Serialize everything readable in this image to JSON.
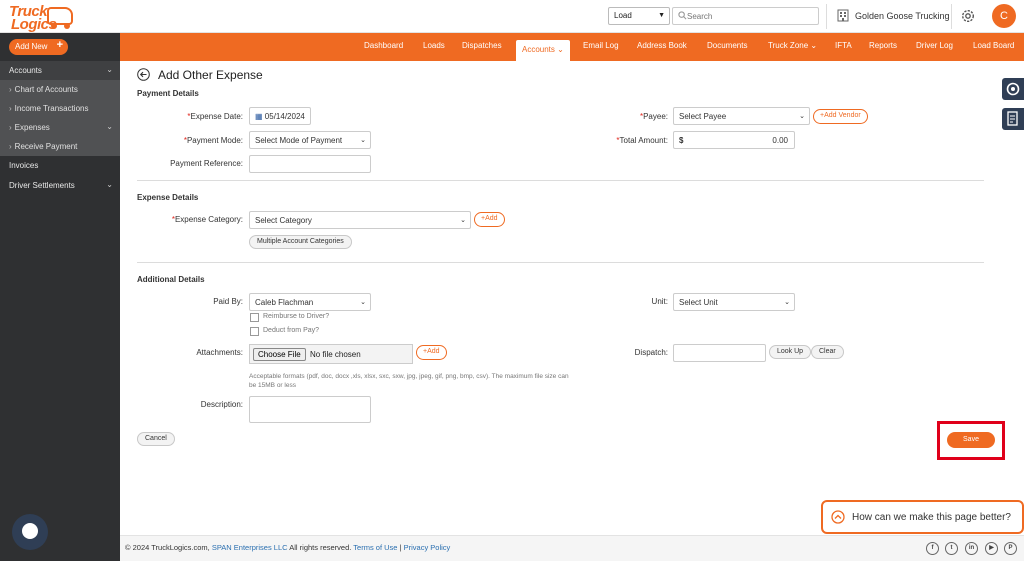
{
  "header": {
    "logo_line1": "Truck",
    "logo_line2": "Logics",
    "load_select": "Load",
    "search_placeholder": "Search",
    "company": "Golden Goose Trucking",
    "avatar_initial": "C"
  },
  "sidebar": {
    "add_new": "Add New",
    "items": [
      {
        "label": "Accounts",
        "type": "parent"
      },
      {
        "label": "Chart of Accounts",
        "type": "sub"
      },
      {
        "label": "Income Transactions",
        "type": "sub"
      },
      {
        "label": "Expenses",
        "type": "sub"
      },
      {
        "label": "Receive Payment",
        "type": "sub"
      },
      {
        "label": "Invoices",
        "type": "top"
      },
      {
        "label": "Driver Settlements",
        "type": "top"
      }
    ]
  },
  "nav": {
    "items": [
      "Dashboard",
      "Loads",
      "Dispatches",
      "Accounts",
      "Email Log",
      "Address Book",
      "Documents",
      "Truck Zone",
      "IFTA",
      "Reports",
      "Driver Log",
      "Load Board"
    ],
    "active": "Accounts"
  },
  "page": {
    "title": "Add Other Expense",
    "sections": {
      "payment": "Payment Details",
      "expense": "Expense Details",
      "additional": "Additional Details"
    },
    "labels": {
      "expense_date": "Expense Date:",
      "payee": "Payee:",
      "payment_mode": "Payment Mode:",
      "total_amount": "Total Amount:",
      "payment_reference": "Payment Reference:",
      "expense_category": "Expense Category:",
      "paid_by": "Paid By:",
      "unit": "Unit:",
      "attachments": "Attachments:",
      "dispatch": "Dispatch:",
      "description": "Description:",
      "reimburse": "Reimburse to Driver?",
      "deduct": "Deduct from Pay?"
    },
    "values": {
      "expense_date": "05/14/2024",
      "payee": "Select Payee",
      "payment_mode": "Select Mode of Payment",
      "currency": "$",
      "total_amount": "0.00",
      "expense_category": "Select Category",
      "paid_by": "Caleb Flachman",
      "unit": "Select Unit",
      "file_button": "Choose File",
      "file_status": "No file chosen"
    },
    "buttons": {
      "add_vendor": "Add Vendor",
      "add_category": "Add",
      "multiple_categories": "Multiple Account Categories",
      "add_attachment": "Add",
      "look_up": "Look Up",
      "clear": "Clear",
      "cancel": "Cancel",
      "save": "Save"
    },
    "hint": "Acceptable formats (pdf, doc, docx ,xls, xlsx, sxc, sxw, jpg, jpeg, gif, png, bmp, csv). The maximum file size can be 15MB or less"
  },
  "feedback": "How can we make this page better?",
  "footer": {
    "copyright": "© 2024 TruckLogics.com,",
    "span": "SPAN Enterprises LLC",
    "rights": "All rights reserved.",
    "terms": "Terms of Use",
    "sep": "|",
    "privacy": "Privacy Policy"
  },
  "colors": {
    "brand": "#ef6a22",
    "sidebar": "#2f3032",
    "highlight": "#e0001a"
  }
}
